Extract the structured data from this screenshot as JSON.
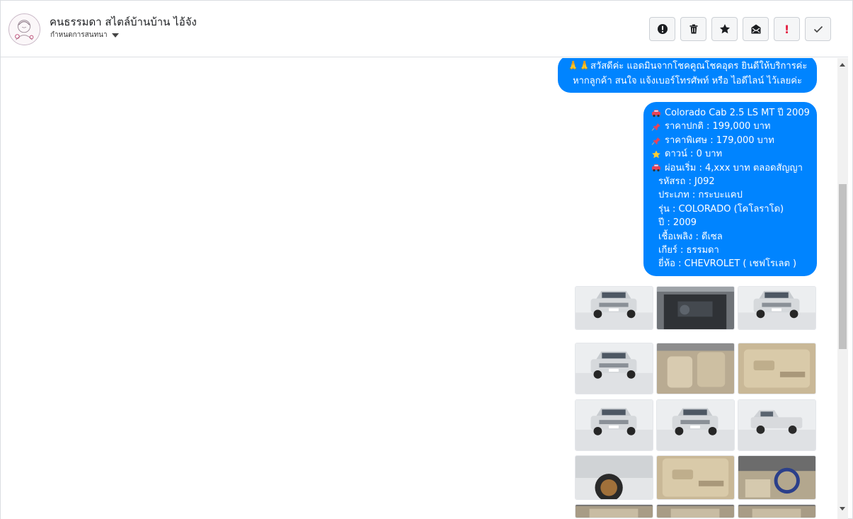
{
  "header": {
    "contact_name": "คนธรรมดา สไตล์บ้านบ้าน ไอ้จัง",
    "label_text": "กำหนดการสนทนา"
  },
  "toolbar": [
    {
      "name": "spam-button",
      "icon": "alert-circle-icon"
    },
    {
      "name": "delete-button",
      "icon": "trash-icon"
    },
    {
      "name": "star-button",
      "icon": "star-icon"
    },
    {
      "name": "mark-unread-button",
      "icon": "envelope-icon"
    },
    {
      "name": "follow-up-button",
      "icon": "exclamation-icon",
      "text": "!"
    },
    {
      "name": "mark-done-button",
      "icon": "check-icon"
    }
  ],
  "messages": {
    "greeting": {
      "line1": "🙏🙏สวัสดีค่ะ แอดมินจากโชคคูณโชคอุดร ยินดีให้บริการค่ะ",
      "line2": "หากลูกค้า สนใจ แจ้งเบอร์โทรศัพท์ หรือ ไอดีไลน์ ไว้เลยค่ะ"
    },
    "car_details": {
      "title": "Colorado Cab 2.5 LS MT ปี 2009",
      "normal_price": "ราคาปกติ : 199,000 บาท",
      "special_price": "ราคาพิเศษ : 179,000 บาท",
      "down_payment": "ดาวน์ : 0 บาท",
      "installment": "ผ่อนเริ่ม : 4,xxx บาท ตลอดสัญญา",
      "car_code": "รหัสรถ : J092",
      "car_type": "ประเภท : กระบะแคป",
      "model": "รุ่น : COLORADO (โคโลราโด)",
      "year": "ปี : 2009",
      "fuel": "เชื้อเพลิง : ดีเซล",
      "gear": "เกียร์ : ธรรมดา",
      "brand": "ยี่ห้อ : CHEVROLET ( เชฟโรเลต )"
    }
  },
  "photos": [
    {
      "subject": "truck-front-three-quarter"
    },
    {
      "subject": "engine-bay"
    },
    {
      "subject": "truck-front-three-quarter"
    },
    {
      "subject": "truck-front"
    },
    {
      "subject": "interior-seats"
    },
    {
      "subject": "door-panel"
    },
    {
      "subject": "truck-front-three-quarter"
    },
    {
      "subject": "truck-front-three-quarter"
    },
    {
      "subject": "truck-side"
    },
    {
      "subject": "wheel-closeup"
    },
    {
      "subject": "door-panel"
    },
    {
      "subject": "dashboard"
    },
    {
      "subject": "interior"
    },
    {
      "subject": "interior"
    },
    {
      "subject": "interior"
    }
  ],
  "colors": {
    "bubble": "#0084ff",
    "bubble_text": "#ffffff",
    "follow_up_mark": "#e41e3f"
  }
}
